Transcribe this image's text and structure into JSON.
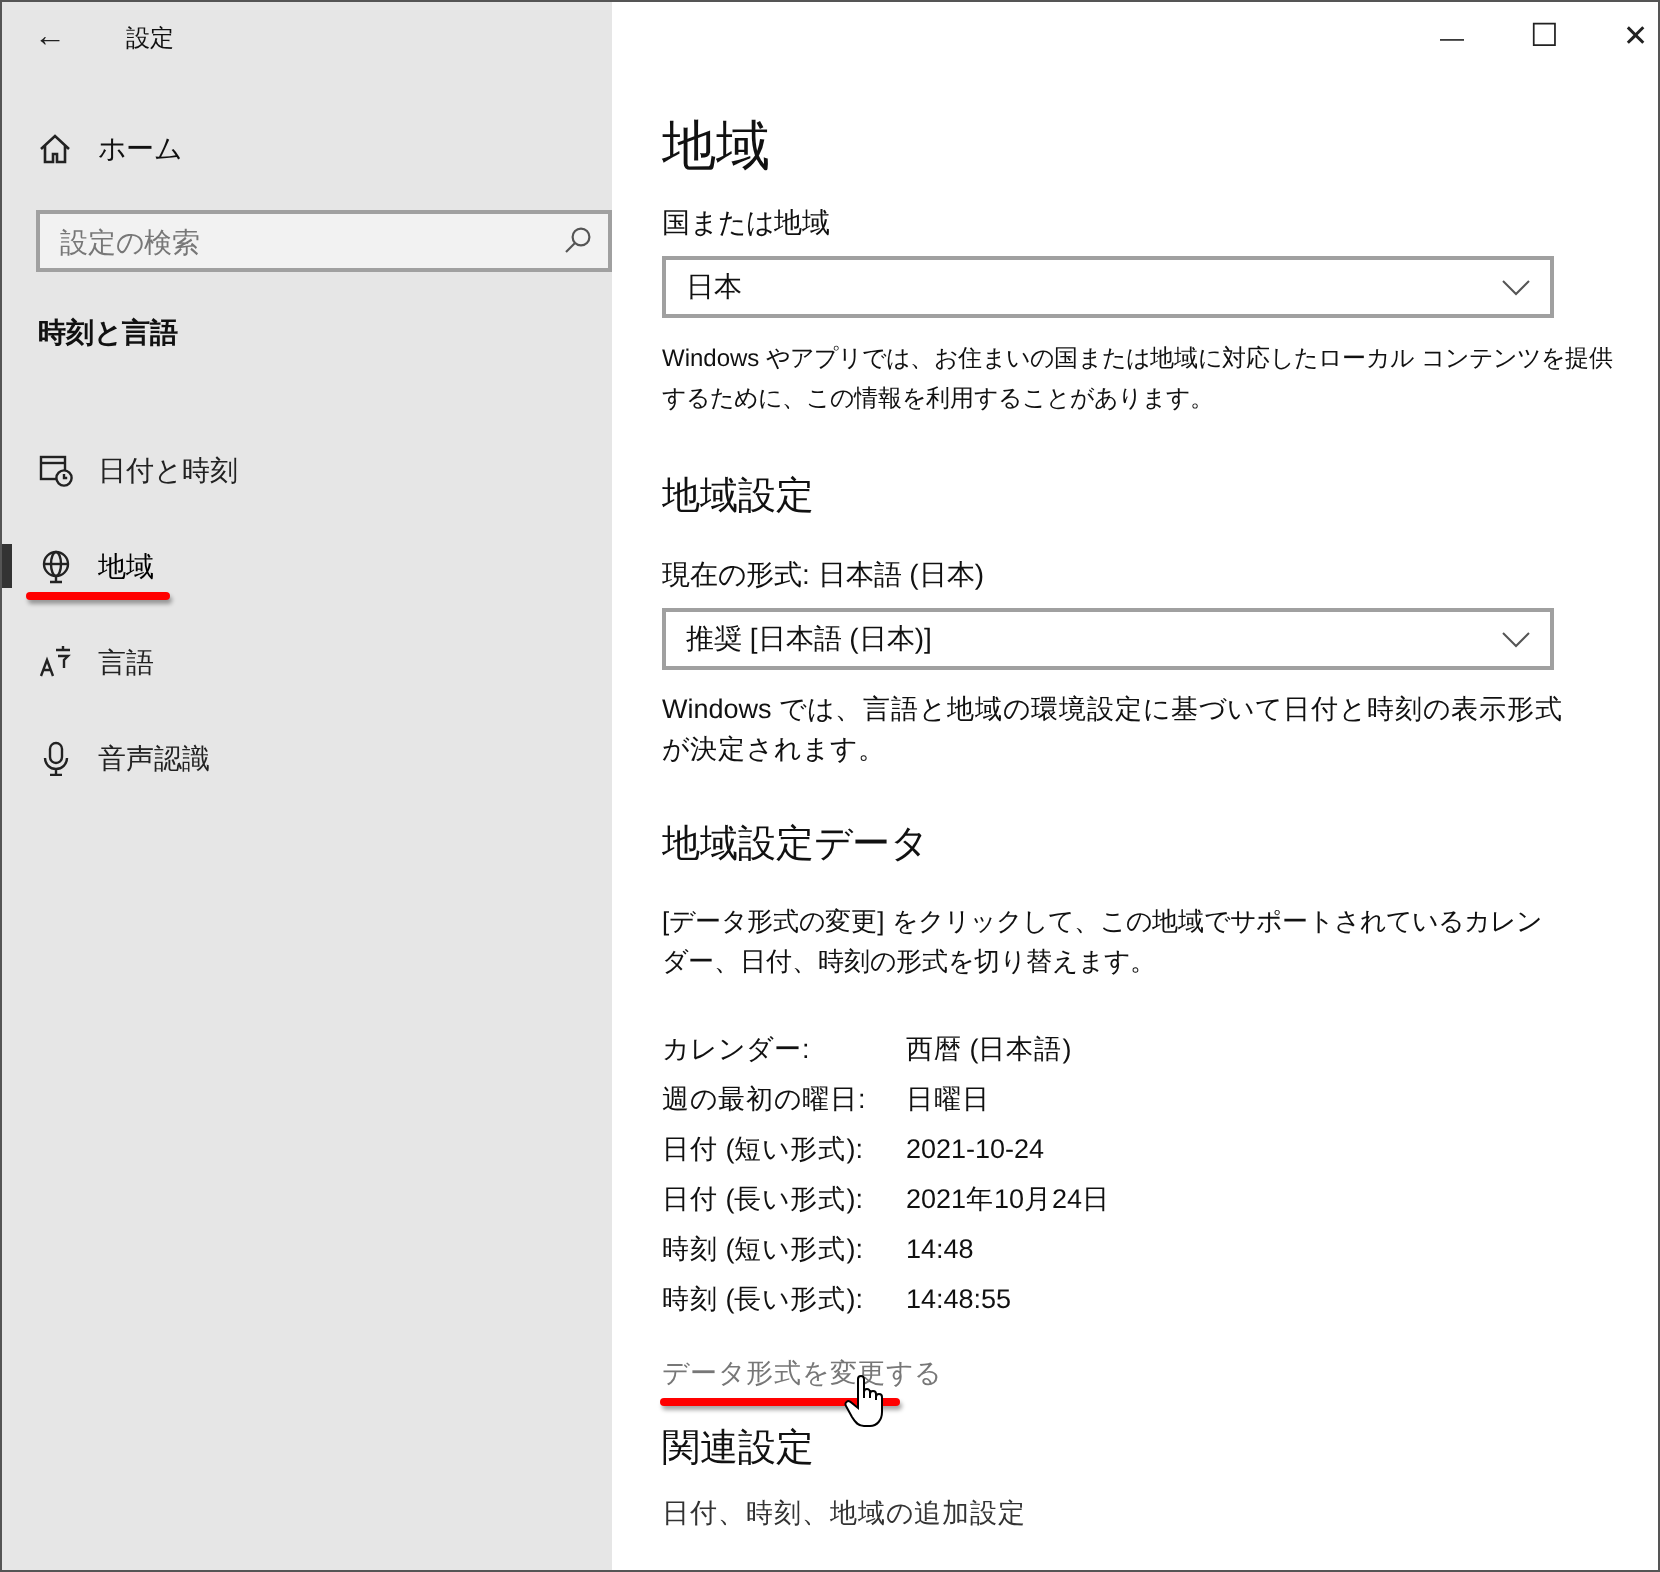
{
  "window": {
    "title": "設定",
    "back": "←",
    "minimize": "—",
    "maximize": "☐",
    "close": "✕"
  },
  "sidebar": {
    "home": "ホーム",
    "search": {
      "placeholder": "設定の検索"
    },
    "section": "時刻と言語",
    "items": [
      {
        "label": "日付と時刻",
        "kind": "calendar",
        "selected": false,
        "underlined": false
      },
      {
        "label": "地域",
        "kind": "globe",
        "selected": true,
        "underlined": true
      },
      {
        "label": "言語",
        "kind": "language",
        "selected": false,
        "underlined": false
      },
      {
        "label": "音声認識",
        "kind": "microphone",
        "selected": false,
        "underlined": false
      }
    ]
  },
  "main": {
    "title": "地域",
    "country": {
      "label": "国または地域",
      "value": "日本",
      "description": "Windows やアプリでは、お住まいの国または地域に対応したローカル コンテンツを提供するために、この情報を利用することがあります。"
    },
    "format": {
      "heading": "地域設定",
      "label": "現在の形式: 日本語 (日本)",
      "value": "推奨 [日本語 (日本)]",
      "description": "Windows では、言語と地域の環境設定に基づいて日付と時刻の表示形式が決定されます。"
    },
    "data": {
      "heading": "地域設定データ",
      "description": "[データ形式の変更] をクリックして、この地域でサポートされているカレンダー、日付、時刻の形式を切り替えます。",
      "rows": [
        {
          "label": "カレンダー:",
          "value": "西暦 (日本語)"
        },
        {
          "label": "週の最初の曜日:",
          "value": "日曜日"
        },
        {
          "label": "日付 (短い形式):",
          "value": "2021-10-24"
        },
        {
          "label": "日付 (長い形式):",
          "value": "2021年10月24日"
        },
        {
          "label": "時刻 (短い形式):",
          "value": "14:48"
        },
        {
          "label": "時刻 (長い形式):",
          "value": "14:48:55"
        }
      ],
      "link": {
        "label": "データ形式を変更する",
        "underlined": true,
        "hovered": true
      }
    },
    "related": {
      "heading": "関連設定",
      "link": "日付、時刻、地域の追加設定"
    }
  }
}
